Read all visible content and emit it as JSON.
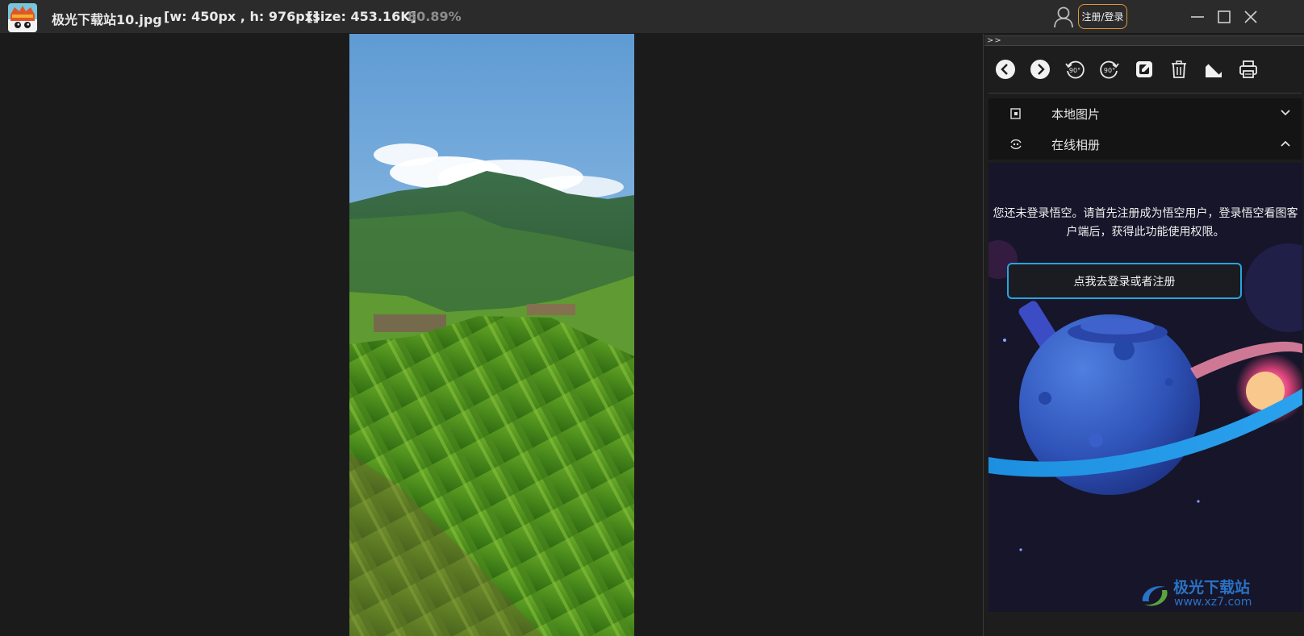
{
  "window": {
    "filename": "极光下载站10.jpg",
    "dimensions": "[w: 450px , h: 976px]",
    "size": "[size: 453.16K]",
    "zoom": "80.89%",
    "login_label": "注册/登录",
    "login_accent_color": "#e0973a"
  },
  "panel": {
    "collapse_label": ">>",
    "toolbar": [
      {
        "name": "previous",
        "icon": "chevron-left-circle-icon"
      },
      {
        "name": "next",
        "icon": "chevron-right-circle-icon"
      },
      {
        "name": "rotate-left-90",
        "icon": "rotate-left-90-icon",
        "label": "90°"
      },
      {
        "name": "rotate-right-90",
        "icon": "rotate-right-90-icon",
        "label": "90°"
      },
      {
        "name": "edit",
        "icon": "edit-icon"
      },
      {
        "name": "delete",
        "icon": "trash-icon"
      },
      {
        "name": "fullscreen",
        "icon": "expand-icon"
      },
      {
        "name": "print",
        "icon": "printer-icon"
      }
    ],
    "sections": {
      "local_label": "本地图片",
      "online_label": "在线相册"
    },
    "online": {
      "notice": "您还未登录悟空。请首先注册成为悟空用户，登录悟空看图客户端后，获得此功能使用权限。",
      "cta_label": "点我去登录或者注册",
      "cta_border_color": "#26a6dd"
    }
  },
  "watermark": {
    "name": "极光下载站",
    "url": "www.xz7.com"
  }
}
